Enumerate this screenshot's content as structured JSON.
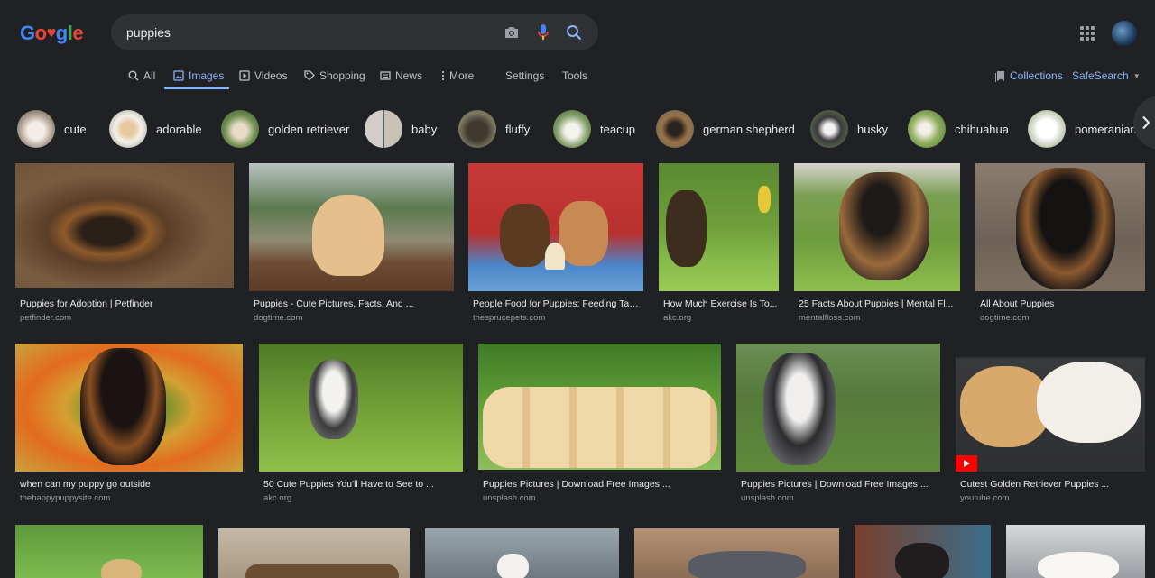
{
  "logo": {
    "letters": [
      "G",
      "o",
      "♥",
      "g",
      "l",
      "e"
    ],
    "colors": [
      "#4285f4",
      "#ea4335",
      "#ea4335",
      "#4285f4",
      "#34a853",
      "#ea4335"
    ]
  },
  "search": {
    "query": "puppies",
    "icons": [
      "camera-icon",
      "mic-icon",
      "search-icon"
    ]
  },
  "nav": {
    "all": "All",
    "images": "Images",
    "videos": "Videos",
    "shopping": "Shopping",
    "news": "News",
    "more": "More",
    "settings": "Settings",
    "tools": "Tools",
    "collections": "Collections",
    "safesearch": "SafeSearch"
  },
  "colors": {
    "accent": "#8ab4f8",
    "background": "#202124",
    "surface": "#303134",
    "muted": "#969ba1"
  },
  "chips": [
    "cute",
    "adorable",
    "golden retriever",
    "baby",
    "fluffy",
    "teacup",
    "german shepherd",
    "husky",
    "chihuahua",
    "pomeranian"
  ],
  "results": [
    {
      "title": "Puppies for Adoption | Petfinder",
      "source": "petfinder.com"
    },
    {
      "title": "Puppies - Cute Pictures, Facts, And ...",
      "source": "dogtime.com"
    },
    {
      "title": "People Food for Puppies: Feeding Tab...",
      "source": "thesprucepets.com"
    },
    {
      "title": "How Much Exercise Is To...",
      "source": "akc.org"
    },
    {
      "title": "25 Facts About Puppies | Mental Fl...",
      "source": "mentalfloss.com"
    },
    {
      "title": "All About Puppies",
      "source": "dogtime.com"
    },
    {
      "title": "when can my puppy go outside",
      "source": "thehappypuppysite.com"
    },
    {
      "title": "50 Cute Puppies You'll Have to See to ...",
      "source": "akc.org"
    },
    {
      "title": "Puppies Pictures | Download Free Images ...",
      "source": "unsplash.com"
    },
    {
      "title": "Puppies Pictures | Download Free Images ...",
      "source": "unsplash.com"
    },
    {
      "title": "Cutest Golden Retriever Puppies ...",
      "source": "youtube.com"
    }
  ]
}
